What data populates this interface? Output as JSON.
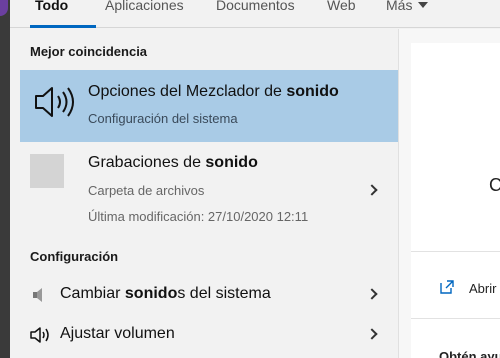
{
  "tabs": [
    {
      "label": "Todo",
      "active": true
    },
    {
      "label": "Aplicaciones",
      "active": false
    },
    {
      "label": "Documentos",
      "active": false
    },
    {
      "label": "Web",
      "active": false
    },
    {
      "label": "Más",
      "active": false
    }
  ],
  "best_match": {
    "header": "Mejor coincidencia",
    "title_pre": "Opciones del Mezclador de ",
    "title_bold": "sonido",
    "subtitle": "Configuración del sistema",
    "icon": "speaker-icon"
  },
  "recordings": {
    "title_pre": "Grabaciones de ",
    "title_bold": "sonido",
    "type": "Carpeta de archivos",
    "modified": "Última modificación: 27/10/2020 12:11"
  },
  "settings": {
    "header": "Configuración",
    "items": [
      {
        "pre": "Cambiar ",
        "bold": "sonido",
        "post": "s del sistema",
        "icon": "sound-settings-icon"
      },
      {
        "pre": "Ajustar volumen",
        "bold": "",
        "post": "",
        "icon": "volume-icon"
      }
    ]
  },
  "preview": {
    "partial_title": "C",
    "open_label": "Abrir",
    "help_label": "Obtén ayu"
  },
  "colors": {
    "selected": "#a9cbe6",
    "accent": "#0067c0"
  }
}
